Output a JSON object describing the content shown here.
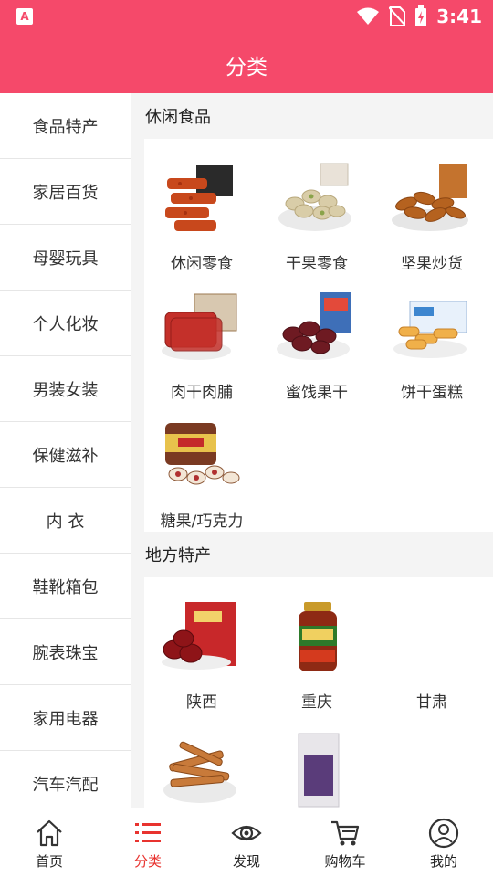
{
  "status_bar": {
    "time": "3:41",
    "app_icon": "A"
  },
  "header": {
    "title": "分类"
  },
  "sidebar": {
    "items": [
      {
        "label": "食品特产"
      },
      {
        "label": "家居百货"
      },
      {
        "label": "母婴玩具"
      },
      {
        "label": "个人化妆"
      },
      {
        "label": "男装女装"
      },
      {
        "label": "保健滋补"
      },
      {
        "label": "内 衣"
      },
      {
        "label": "鞋靴箱包"
      },
      {
        "label": "腕表珠宝"
      },
      {
        "label": "家用电器"
      },
      {
        "label": "汽车汽配"
      }
    ]
  },
  "sections": [
    {
      "title": "休闲食品",
      "items": [
        {
          "label": "休闲零食",
          "icon": "snack-icon"
        },
        {
          "label": "干果零食",
          "icon": "pistachio-icon"
        },
        {
          "label": "坚果炒货",
          "icon": "almond-icon"
        },
        {
          "label": "肉干肉脯",
          "icon": "jerky-icon"
        },
        {
          "label": "蜜饯果干",
          "icon": "dates-icon"
        },
        {
          "label": "饼干蛋糕",
          "icon": "biscuit-icon"
        },
        {
          "label": "糖果/巧克力",
          "icon": "candy-icon"
        }
      ]
    },
    {
      "title": "地方特产",
      "items": [
        {
          "label": "陕西",
          "icon": "red-dates-icon"
        },
        {
          "label": "重庆",
          "icon": "chili-jar-icon"
        },
        {
          "label": "甘肃",
          "icon": "empty"
        },
        {
          "label": "",
          "icon": "dried-meat-icon"
        },
        {
          "label": "",
          "icon": "packet-icon"
        }
      ]
    }
  ],
  "bottom_nav": [
    {
      "label": "首页",
      "icon": "home-icon",
      "active": false
    },
    {
      "label": "分类",
      "icon": "list-icon",
      "active": true
    },
    {
      "label": "发现",
      "icon": "eye-icon",
      "active": false
    },
    {
      "label": "购物车",
      "icon": "cart-icon",
      "active": false
    },
    {
      "label": "我的",
      "icon": "user-icon",
      "active": false
    }
  ],
  "colors": {
    "brand": "#f5496a",
    "active_nav": "#e8332f"
  }
}
